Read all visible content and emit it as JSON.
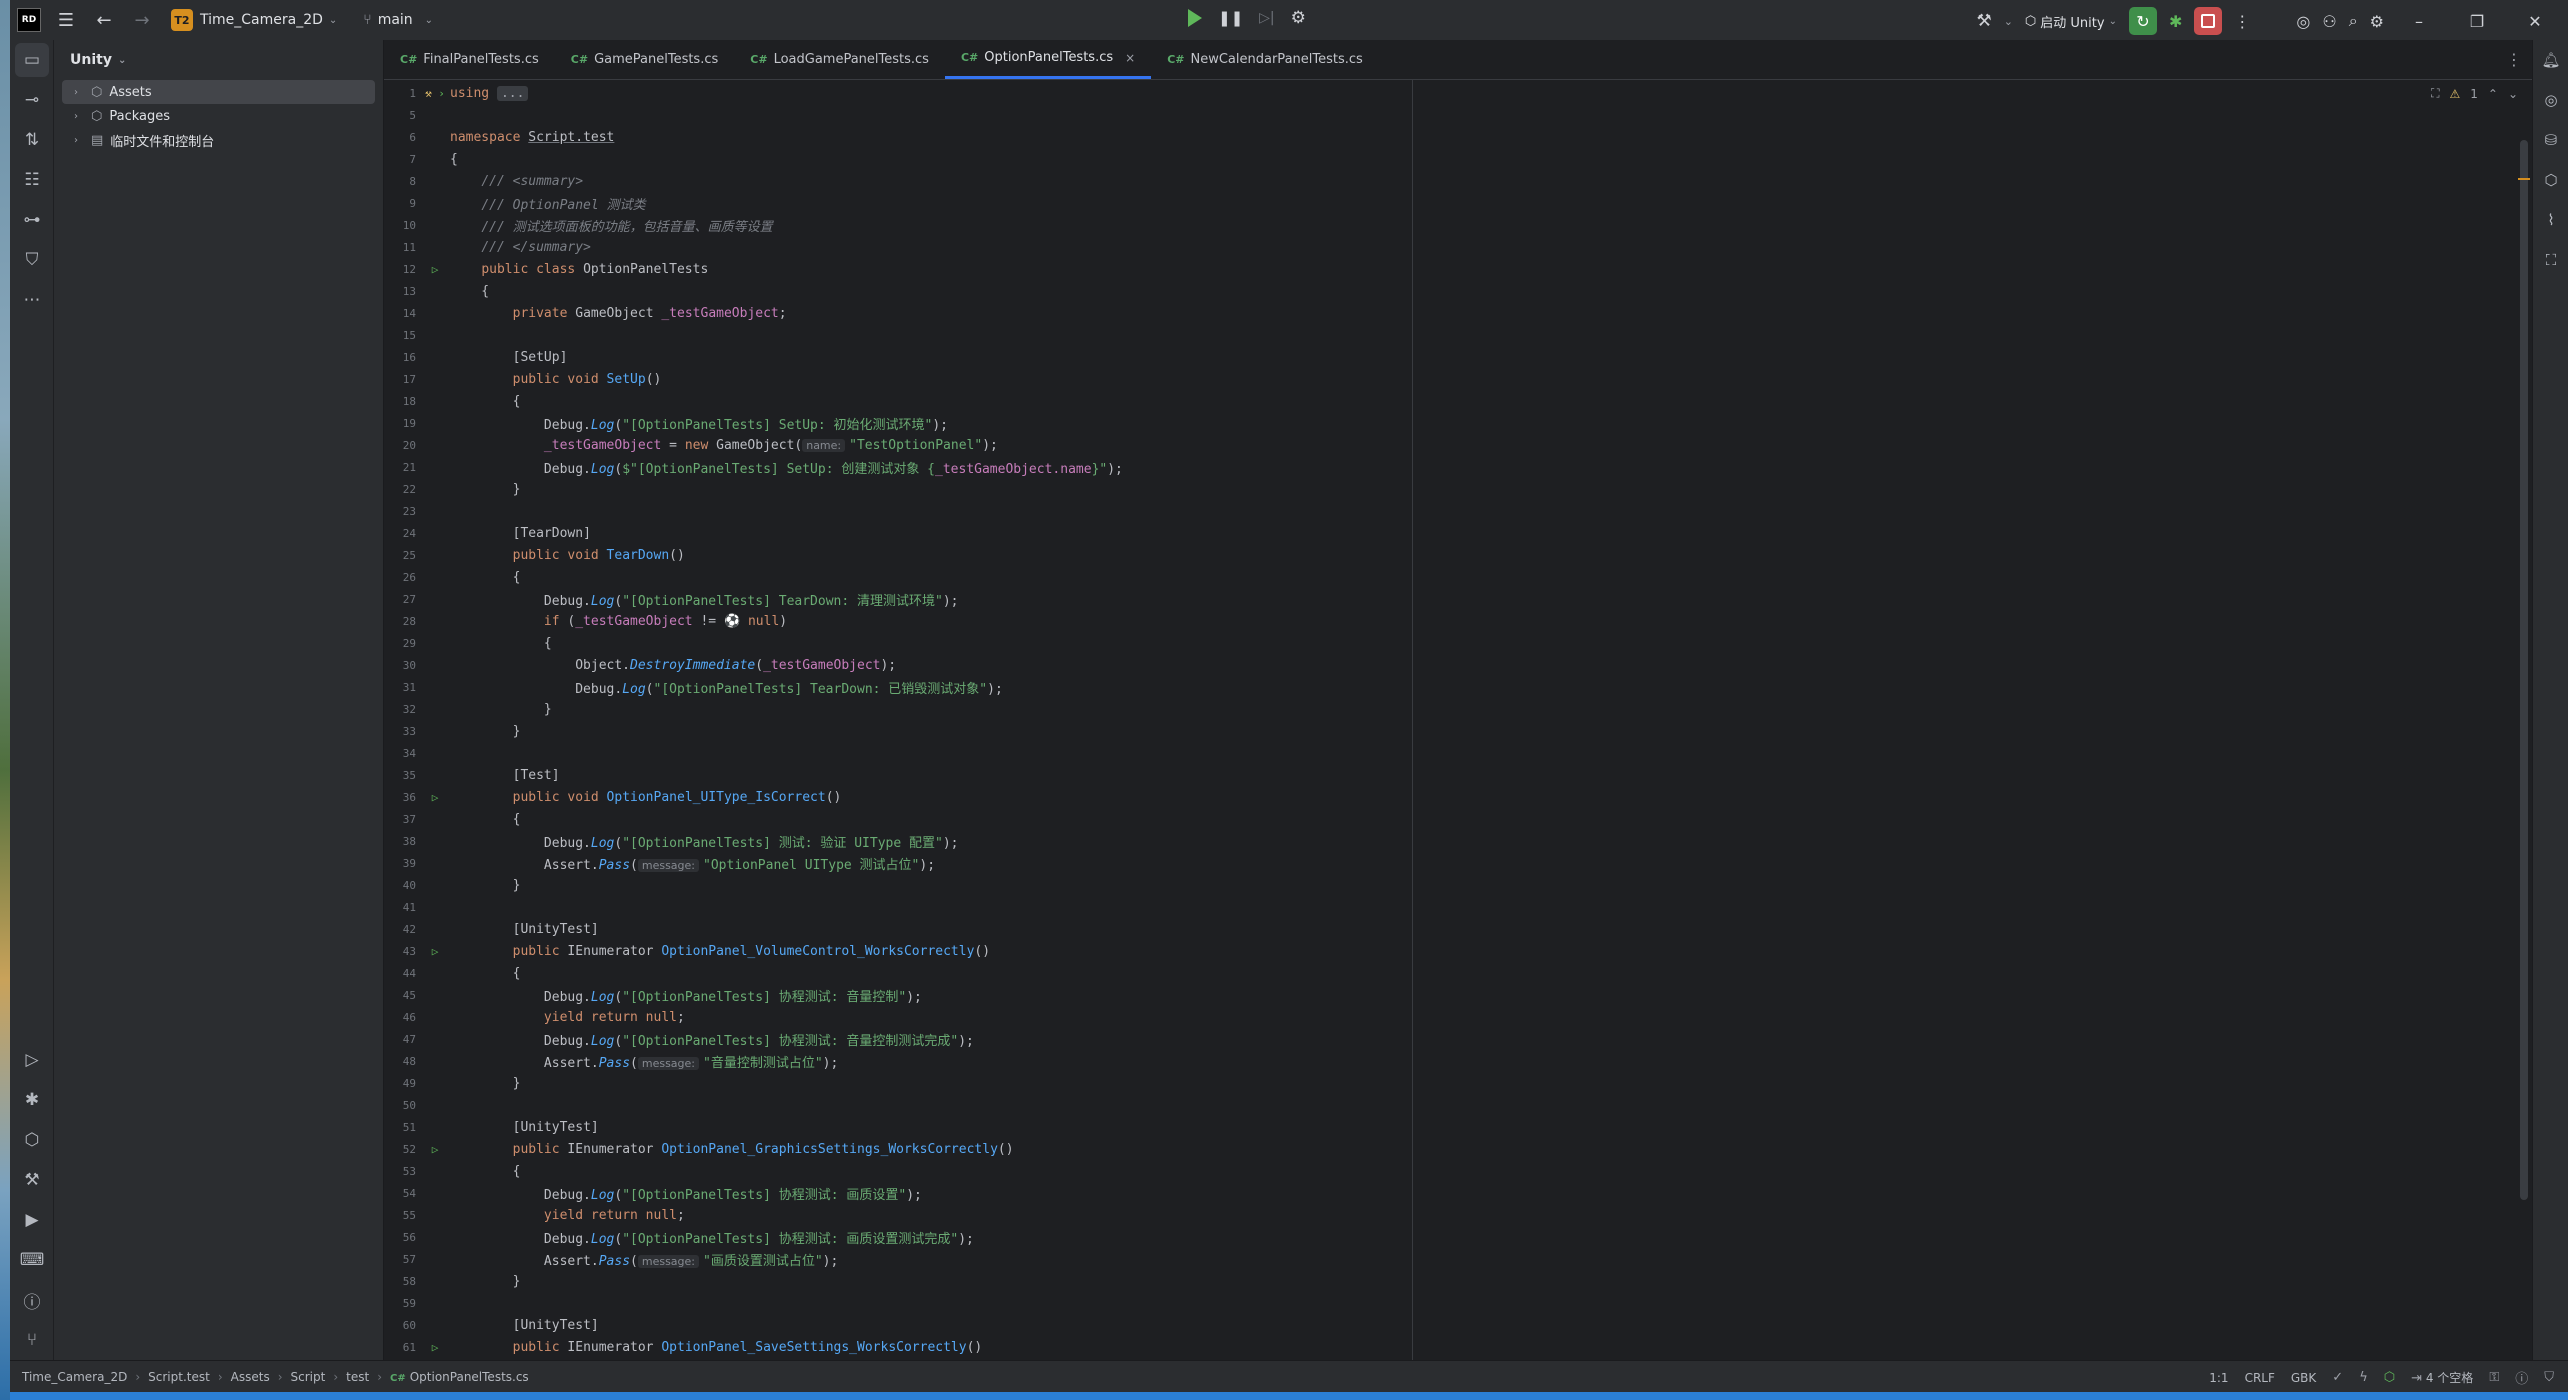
{
  "titlebar": {
    "logo": "RD",
    "project_badge": "T2",
    "project_name": "Time_Camera_2D",
    "branch": "main",
    "run_config": "启动 Unity"
  },
  "project_panel": {
    "title": "Unity",
    "items": [
      {
        "label": "Assets",
        "selected": true
      },
      {
        "label": "Packages",
        "selected": false
      },
      {
        "label": "临时文件和控制台",
        "selected": false
      }
    ]
  },
  "tabs": [
    {
      "lang": "C#",
      "label": "FinalPanelTests.cs",
      "active": false
    },
    {
      "lang": "C#",
      "label": "GamePanelTests.cs",
      "active": false
    },
    {
      "lang": "C#",
      "label": "LoadGamePanelTests.cs",
      "active": false
    },
    {
      "lang": "C#",
      "label": "OptionPanelTests.cs",
      "active": true,
      "close": "×"
    },
    {
      "lang": "C#",
      "label": "NewCalendarPanelTests.cs",
      "active": false
    }
  ],
  "editor": {
    "warning_count": "1",
    "line_numbers": [
      "1",
      "5",
      "6",
      "7",
      "8",
      "9",
      "10",
      "11",
      "12",
      "13",
      "14",
      "15",
      "16",
      "17",
      "18",
      "19",
      "20",
      "21",
      "22",
      "23",
      "24",
      "25",
      "26",
      "27",
      "28",
      "29",
      "30",
      "31",
      "32",
      "33",
      "34",
      "35",
      "36",
      "37",
      "38",
      "39",
      "40",
      "41",
      "42",
      "43",
      "44",
      "45",
      "46",
      "47",
      "48",
      "49",
      "50",
      "51",
      "52",
      "53",
      "54",
      "55",
      "56",
      "57",
      "58",
      "59",
      "60",
      "61"
    ]
  },
  "code": {
    "using": "using",
    "fold": "...",
    "ns_kw": "namespace",
    "ns_name": "Script.test",
    "summary_open": "/// <summary>",
    "summary_1": "/// OptionPanel 测试类",
    "summary_2": "/// 测试选项面板的功能，包括音量、画质等设置",
    "summary_close": "/// </summary>",
    "class_decl": "OptionPanelTests",
    "field_type": "GameObject",
    "field_name": "_testGameObject",
    "setup_attr": "[SetUp]",
    "setup_fn": "SetUp",
    "setup_log1": "\"[OptionPanelTests] SetUp: 初始化测试环境\"",
    "setup_hint": "name:",
    "setup_str2": "\"TestOptionPanel\"",
    "setup_log3a": "$\"[OptionPanelTests] SetUp: 创建测试对象 {",
    "setup_log3b": "_testGameObject.name",
    "setup_log3c": "}\"",
    "teardown_attr": "[TearDown]",
    "teardown_fn": "TearDown",
    "teardown_log1": "\"[OptionPanelTests] TearDown: 清理测试环境\"",
    "teardown_destroy": "DestroyImmediate",
    "teardown_log2": "\"[OptionPanelTests] TearDown: 已销毁测试对象\"",
    "test_attr": "[Test]",
    "test_fn": "OptionPanel_UIType_IsCorrect",
    "test_log": "\"[OptionPanelTests] 测试: 验证 UIType 配置\"",
    "msg_hint": "message:",
    "test_pass": "\"OptionPanel UIType 测试占位\"",
    "unity_attr": "[UnityTest]",
    "vol_fn": "OptionPanel_VolumeControl_WorksCorrectly",
    "vol_log1": "\"[OptionPanelTests] 协程测试: 音量控制\"",
    "vol_log2": "\"[OptionPanelTests] 协程测试: 音量控制测试完成\"",
    "vol_pass": "\"音量控制测试占位\"",
    "gfx_fn": "OptionPanel_GraphicsSettings_WorksCorrectly",
    "gfx_log1": "\"[OptionPanelTests] 协程测试: 画质设置\"",
    "gfx_log2": "\"[OptionPanelTests] 协程测试: 画质设置测试完成\"",
    "gfx_pass": "\"画质设置测试占位\"",
    "save_fn": "OptionPanel_SaveSettings_WorksCorrectly"
  },
  "statusbar": {
    "breadcrumbs": [
      "Time_Camera_2D",
      "Script.test",
      "Assets",
      "Script",
      "test"
    ],
    "file": "OptionPanelTests.cs",
    "position": "1:1",
    "line_sep": "CRLF",
    "encoding": "GBK",
    "indent": "4 个空格"
  }
}
